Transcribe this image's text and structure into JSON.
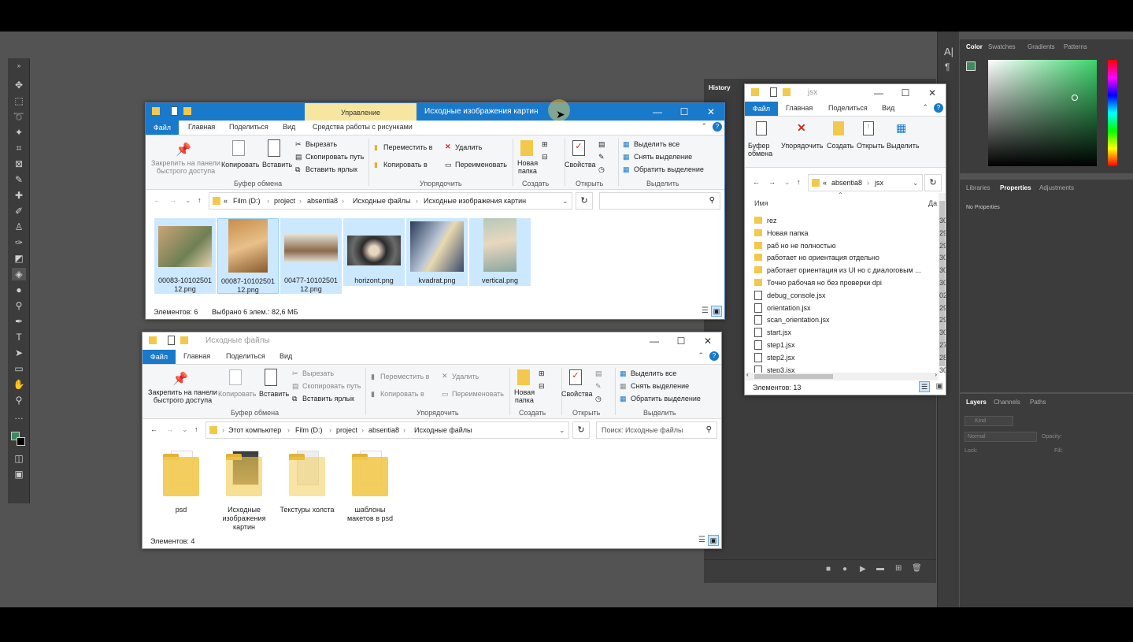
{
  "photoshop": {
    "history_tab": "History",
    "color_panel": {
      "tabs": [
        "Color",
        "Swatches",
        "Gradients",
        "Patterns"
      ],
      "active": "Color",
      "fg_color": "#3d8a5c",
      "bg_color": "#000000"
    },
    "props_panel": {
      "tabs": [
        "Libraries",
        "Properties",
        "Adjustments"
      ],
      "active": "Properties",
      "text": "No Properties"
    },
    "layers_panel": {
      "tabs": [
        "Layers",
        "Channels",
        "Paths"
      ],
      "active": "Layers",
      "kind": "Kind",
      "blend": "Normal",
      "opacity_label": "Opacity:",
      "lock_label": "Lock:",
      "fill_label": "Fill:"
    },
    "side_glyphs": [
      "A|",
      "¶"
    ]
  },
  "win1": {
    "title": "Исходные изображения картин",
    "context_tab": "Управление",
    "tabs": [
      "Файл",
      "Главная",
      "Поделиться",
      "Вид",
      "Средства работы с рисунками"
    ],
    "ribbon": {
      "pin": "Закрепить на панели быстрого доступа",
      "copy": "Копировать",
      "paste": "Вставить",
      "cut": "Вырезать",
      "copy_path": "Скопировать путь",
      "paste_shortcut": "Вставить ярлык",
      "clipboard": "Буфер обмена",
      "move_to": "Переместить в",
      "copy_to": "Копировать в",
      "delete": "Удалить",
      "rename": "Переименовать",
      "organize": "Упорядочить",
      "new_folder": "Новая папка",
      "create": "Создать",
      "properties": "Свойства",
      "open": "Открыть",
      "select_all": "Выделить все",
      "select_none": "Снять выделение",
      "invert": "Обратить выделение",
      "select": "Выделить"
    },
    "path": [
      "«",
      "Film (D:)",
      "project",
      "absentia8",
      "Исходные файлы",
      "Исходные изображения картин"
    ],
    "files": [
      {
        "name": "00083-1010250112.png",
        "line1": "00083-10102501",
        "line2": "12.png",
        "selected": true
      },
      {
        "name": "00087-1010250112.png",
        "line1": "00087-10102501",
        "line2": "12.png",
        "selected": true
      },
      {
        "name": "00477-1010250112.png",
        "line1": "00477-10102501",
        "line2": "12.png",
        "selected": true
      },
      {
        "name": "horizont.png",
        "line1": "horizont.png",
        "line2": "",
        "selected": true
      },
      {
        "name": "kvadrat.png",
        "line1": "kvadrat.png",
        "line2": "",
        "selected": true
      },
      {
        "name": "vertical.png",
        "line1": "vertical.png",
        "line2": "",
        "selected": true
      }
    ],
    "status_count": "Элементов: 6",
    "status_selected": "Выбрано 6 элем.: 82,6 МБ"
  },
  "win2": {
    "title": "Исходные файлы",
    "tabs": [
      "Файл",
      "Главная",
      "Поделиться",
      "Вид"
    ],
    "path": [
      "Этот компьютер",
      "Film (D:)",
      "project",
      "absentia8",
      "Исходные файлы"
    ],
    "search_placeholder": "Поиск: Исходные файлы",
    "folders": [
      {
        "line1": "psd",
        "line2": "",
        "line3": ""
      },
      {
        "line1": "Исходные",
        "line2": "изображения",
        "line3": "картин"
      },
      {
        "line1": "Текстуры холста",
        "line2": "",
        "line3": ""
      },
      {
        "line1": "шаблоны",
        "line2": "макетов в psd",
        "line3": ""
      }
    ],
    "status_count": "Элементов: 4"
  },
  "win3": {
    "title": "jsx",
    "tabs": [
      "Файл",
      "Главная",
      "Поделиться",
      "Вид"
    ],
    "ribbon": {
      "clipboard": "Буфер обмена",
      "organize": "Упорядочить",
      "create": "Создать",
      "open": "Открыть",
      "select": "Выделить"
    },
    "path": [
      "«",
      "absentia8",
      "jsx"
    ],
    "col_name": "Имя",
    "col_date": "Да",
    "rows": [
      {
        "name": "rez",
        "type": "folder",
        "date": "30"
      },
      {
        "name": "Новая папка",
        "type": "folder",
        "date": "29"
      },
      {
        "name": "раб но не полностью",
        "type": "folder",
        "date": "29"
      },
      {
        "name": "работает но ориентация отдельно",
        "type": "folder",
        "date": "30"
      },
      {
        "name": "работает ориентация из UI но с диалоговым ...",
        "type": "folder",
        "date": "30"
      },
      {
        "name": "Точно рабочая но без проверки dpi",
        "type": "folder",
        "date": "30"
      },
      {
        "name": "debug_console.jsx",
        "type": "jsx",
        "date": "02"
      },
      {
        "name": "orientation.jsx",
        "type": "jsx",
        "date": "29"
      },
      {
        "name": "scan_orientation.jsx",
        "type": "jsx",
        "date": "29"
      },
      {
        "name": "start.jsx",
        "type": "jsx",
        "date": "30"
      },
      {
        "name": "step1.jsx",
        "type": "jsx",
        "date": "27"
      },
      {
        "name": "step2.jsx",
        "type": "jsx",
        "date": "28"
      },
      {
        "name": "step3.jsx",
        "type": "jsx",
        "date": "30"
      }
    ],
    "status_count": "Элементов: 13"
  }
}
